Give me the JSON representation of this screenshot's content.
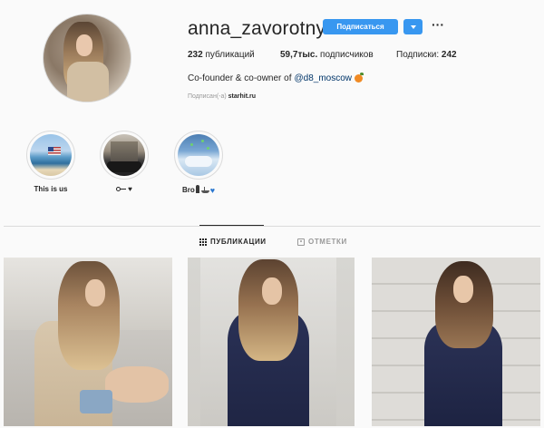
{
  "profile": {
    "username": "anna_zavorotnyuk",
    "follow_label": "Подписаться",
    "more_label": "···",
    "stats": {
      "posts_value": "232",
      "posts_label": "публикаций",
      "followers_value": "59,7тыс.",
      "followers_label": "подписчиков",
      "following_label": "Подписки:",
      "following_value": "242"
    },
    "bio_text": "Co-founder & co-owner of",
    "bio_mention": "@d8_moscow",
    "followed_by_label": "Подписан(-а)",
    "followed_by_account": "starhit.ru"
  },
  "highlights": [
    {
      "label": "This is us"
    },
    {
      "label": ""
    },
    {
      "label": "Bro"
    }
  ],
  "tabs": {
    "posts_label": "ПУБЛИКАЦИИ",
    "tagged_label": "ОТМЕТКИ"
  },
  "colors": {
    "accent": "#3897f0",
    "text": "#262626",
    "muted": "#999999",
    "background": "#fafafa"
  }
}
